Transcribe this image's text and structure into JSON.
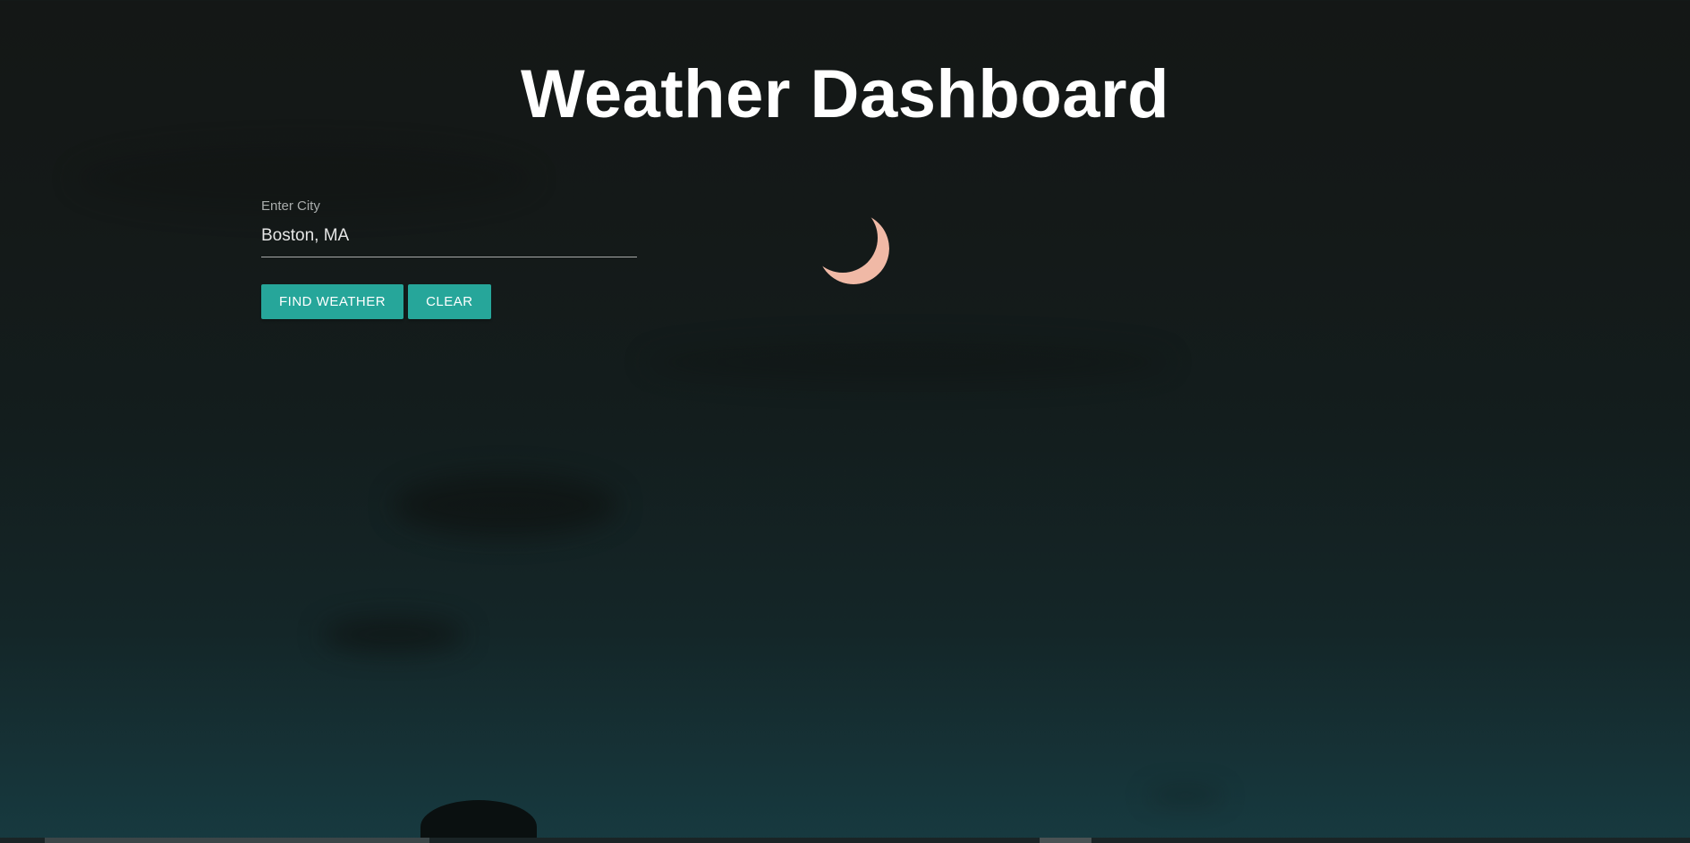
{
  "header": {
    "title": "Weather Dashboard"
  },
  "search": {
    "label": "Enter City",
    "value": "Boston, MA"
  },
  "actions": {
    "find_label": "Find Weather",
    "clear_label": "Clear"
  },
  "theme": {
    "accent": "#26a69a",
    "background_top": "#141716",
    "background_bottom": "#173a40"
  }
}
